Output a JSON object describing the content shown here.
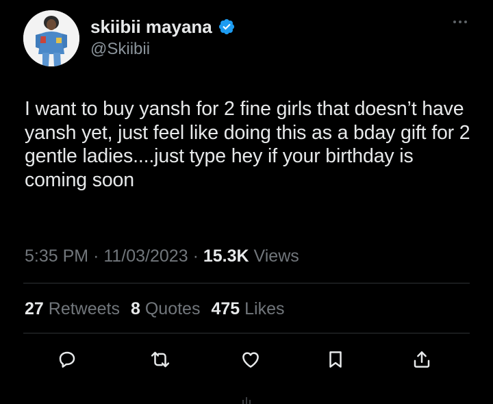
{
  "author": {
    "display_name": "skiibii mayana",
    "handle": "@Skiibii",
    "verified": true,
    "avatar_icon": "avatar-icon",
    "verified_color": "#1d9bf0"
  },
  "tweet": {
    "text": "I want to buy yansh for 2 fine girls that doesn’t have yansh yet, just feel like doing this as a bday gift for 2 gentle ladies....just type hey if your birthday is coming soon",
    "time": "5:35 PM",
    "separator": "·",
    "date": "11/03/2023",
    "views_count": "15.3K",
    "views_label": "Views"
  },
  "stats": {
    "retweets_count": "27",
    "retweets_label": "Retweets",
    "quotes_count": "8",
    "quotes_label": "Quotes",
    "likes_count": "475",
    "likes_label": "Likes"
  },
  "actions": [
    {
      "icon": "reply-icon"
    },
    {
      "icon": "retweet-icon"
    },
    {
      "icon": "like-icon"
    },
    {
      "icon": "bookmark-icon"
    },
    {
      "icon": "share-icon"
    }
  ],
  "colors": {
    "background": "#000000",
    "text_primary": "#e7e9ea",
    "text_secondary": "#71767b",
    "divider": "#2f3336"
  }
}
